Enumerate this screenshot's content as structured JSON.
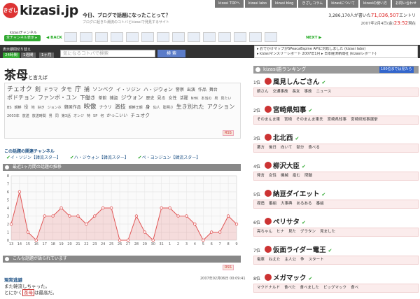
{
  "top_nav": [
    "kizasi TOPへ",
    "kizasi labo",
    "kizasi blog",
    "きざしコラム",
    "kizasiについて",
    "kizasiの使い方",
    "お問い合わせ"
  ],
  "logo": {
    "badge": "きざし",
    "text": "kizasi.jp"
  },
  "tagline": "今日、ブログで話題になったことって？",
  "subtag": "ブログに起きた潮流のコトバとkizasiで発見するサイト",
  "counter": {
    "prefix": "3,286,170人が書いた",
    "num": "71,036,507",
    "suffix": "エントリ"
  },
  "date": {
    "text": "2007年2月4日(金)",
    "time": "23:52",
    "suffix": "現在"
  },
  "channel": {
    "line": "kizasiチャンネル",
    "button": "全チャンネル表示 ▸"
  },
  "nav": {
    "back": "◀ BACK",
    "next": "NEXT ▶"
  },
  "search": {
    "label": "表示期間切り替え",
    "periods": [
      "24時間",
      "1週間",
      "1ヶ月"
    ],
    "placeholder": "気になるコトバで検索",
    "button": "検 索"
  },
  "news": [
    "▸ おでかけマップがSPeacaBspine APIに対応しました (kizasi labo)",
    "▸ kizasiマンスリーレポート 2007年1月 ▸ 日本経済新聞社 (kizasiレポート)"
  ],
  "page": {
    "title": "茶母",
    "title_suffix": "と言えば"
  },
  "cloud": [
    "チェオク",
    "剣",
    "ドラマ",
    "タモ",
    "庁",
    "捕",
    "ソンベク",
    "イ・ソジン",
    "ハ・ジウォン",
    "警察",
    "出演",
    "作品",
    "舞台",
    "ポドチョン",
    "ファンボ・ユン",
    "下働き",
    "茶館",
    "捕盗",
    "ジウォン",
    "歴史",
    "見る",
    "女性",
    "活躍",
    "NHK",
    "本当の",
    "男",
    "見たい",
    "BS",
    "朝鮮",
    "役",
    "地",
    "好き",
    "ジョンホ",
    "韓国作品",
    "映像",
    "ナウリ",
    "演技",
    "朝鮮王朝",
    "身",
    "仙人",
    "聡明さ",
    "生き別れた",
    "アクション",
    "2003年",
    "放送",
    "放送時間",
    "男",
    "同",
    "第3話",
    "オンジ",
    "特",
    "SP",
    "何",
    "かっこいい",
    "チュオク"
  ],
  "rss": "RSS",
  "related": {
    "title": "この話題の関連チャンネル",
    "items": [
      "イ・ソジン【韓流スター】",
      "ハ・ジウォン【韓流スター】",
      "ペ・ヨンジュン【韓流スター】"
    ]
  },
  "chart_section": "最近1ヶ月間の話題の推移",
  "talk_section": "こんな話題が語られています",
  "chart_data": {
    "type": "line",
    "categories": [
      "13",
      "14",
      "15",
      "16",
      "17",
      "18",
      "19",
      "20",
      "21",
      "22",
      "23",
      "24",
      "25",
      "26",
      "27",
      "28",
      "29",
      "30",
      "31",
      "1",
      "2",
      "3",
      "4",
      "5",
      "6",
      "7",
      "8",
      "9"
    ],
    "values": [
      2,
      6,
      1,
      0,
      3,
      3,
      4,
      3,
      3,
      2,
      3,
      4,
      4,
      0,
      0,
      3,
      1,
      0,
      4,
      4,
      3,
      3,
      2,
      0,
      1,
      1,
      3,
      2
    ],
    "ylim": [
      0,
      8
    ],
    "yticks": [
      "0",
      "1",
      "2",
      "3",
      "4",
      "5",
      "6",
      "7",
      "8"
    ],
    "color": "#e05555",
    "grid": true
  },
  "entry": {
    "title": "現実逃避",
    "date": "2007年02月06日 00:09:41",
    "line1": "また韓流しちゃった。",
    "pre": "とにかく",
    "hl": "茶母",
    "post": "は最高だ。"
  },
  "ranking": {
    "title": "kizasi語ランキング",
    "top": "100位までは見たら",
    "items": [
      {
        "no": "1位",
        "name": "風見しんごさん",
        "tags": [
          "娘さん",
          "交通事故",
          "長女",
          "事故",
          "ニュース"
        ]
      },
      {
        "no": "2位",
        "name": "宮崎県知事",
        "tags": [
          "そのまんま東",
          "宮崎",
          "そのまんま東氏",
          "宮崎県知事",
          "宮崎県知事選挙"
        ]
      },
      {
        "no": "3位",
        "name": "北北西",
        "tags": [
          "悪方",
          "後日",
          "向いて",
          "部分",
          "食べる"
        ]
      },
      {
        "no": "4位",
        "name": "柳沢大臣",
        "tags": [
          "発言",
          "女性",
          "機械",
          "産む",
          "問題"
        ]
      },
      {
        "no": "5位",
        "name": "納豆ダイエット",
        "tags": [
          "捏造",
          "番組",
          "大事典",
          "あるある",
          "番組"
        ]
      },
      {
        "no": "6位",
        "name": "ペリサタ",
        "tags": [
          "亮ちゃん",
          "ヒナ",
          "見た",
          "グラタン",
          "見ました"
        ]
      },
      {
        "no": "7位",
        "name": "仮面ライダー電王",
        "tags": [
          "電車",
          "ねえた",
          "主人公",
          "争",
          "スタート"
        ]
      },
      {
        "no": "8位",
        "name": "メガマック",
        "tags": [
          "マクドナルド",
          "食べた",
          "食べました",
          "ビッグマック",
          "食べ"
        ]
      }
    ]
  }
}
